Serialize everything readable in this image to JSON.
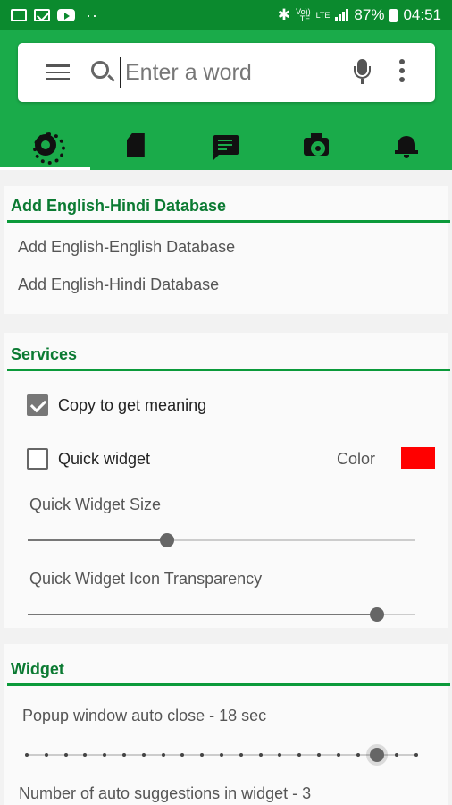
{
  "status_bar": {
    "battery": "87%",
    "time": "04:51",
    "net1": "Vo))\nLTE",
    "net2": "LTE"
  },
  "search": {
    "placeholder": "Enter a word"
  },
  "tabs": [
    {
      "icon": "gear-icon",
      "active": true
    },
    {
      "icon": "sd-card-icon",
      "active": false
    },
    {
      "icon": "chat-icon",
      "active": false
    },
    {
      "icon": "camera-icon",
      "active": false
    },
    {
      "icon": "bell-icon",
      "active": false
    }
  ],
  "database": {
    "title": "Add English-Hindi Database",
    "items": [
      "Add English-English Database",
      "Add English-Hindi Database"
    ]
  },
  "services": {
    "title": "Services",
    "copy_label": "Copy to get meaning",
    "copy_checked": true,
    "quick_widget_label": "Quick widget",
    "quick_widget_checked": false,
    "color_label": "Color",
    "color_value": "#ff0000",
    "size_label": "Quick Widget Size",
    "size_value": 0.36,
    "transparency_label": "Quick Widget Icon Transparency",
    "transparency_value": 0.9
  },
  "widget": {
    "title": "Widget",
    "auto_close_label": "Popup window auto close - 18 sec",
    "auto_close_step": 18,
    "auto_close_steps": 20,
    "suggestions_label": "Number of auto suggestions in widget - 3"
  },
  "colors": {
    "status_bar": "#0b8a2e",
    "app_bar": "#1aab4a",
    "section_title": "#0b7a32"
  }
}
